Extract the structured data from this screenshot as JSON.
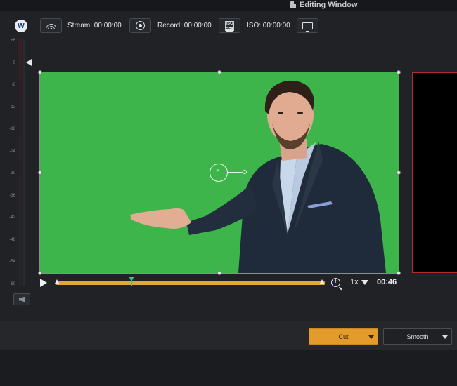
{
  "window": {
    "title": "Editing Window"
  },
  "toolbar": {
    "logo_letter": "W",
    "stream_label": "Stream:",
    "stream_time": "00:00:00",
    "record_label": "Record:",
    "record_time": "00:00:00",
    "iso_badge_top": "ISO",
    "iso_badge_bottom": "REC",
    "iso_label": "ISO:",
    "iso_time": "00:00:00"
  },
  "meter": {
    "ticks": [
      "+6",
      "0",
      "-6",
      "-12",
      "-18",
      "-24",
      "-30",
      "-36",
      "-42",
      "-48",
      "-54",
      "-60"
    ]
  },
  "playback": {
    "speed": "1x",
    "time": "00:46",
    "progress": 0.28
  },
  "transition": {
    "cut_label": "Cut",
    "smooth_label": "Smooth"
  },
  "colors": {
    "stage_green": "#3db54a",
    "accent_orange": "#e39b2b",
    "playhead_teal": "#39c08f",
    "preview_border": "#b62a2a"
  },
  "icons": [
    "wifi-icon",
    "record-icon",
    "iso-record-icon",
    "monitor-icon",
    "play-icon",
    "zoom-in-icon",
    "speaker-icon",
    "document-icon"
  ]
}
